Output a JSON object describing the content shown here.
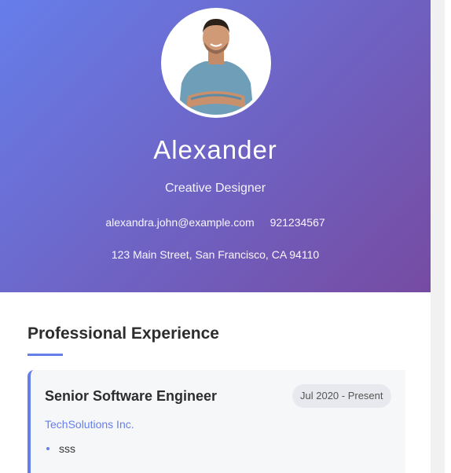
{
  "profile": {
    "name": "Alexander",
    "title": "Creative Designer",
    "email": "alexandra.john@example.com",
    "phone": "921234567",
    "address": "123 Main Street, San Francisco, CA 94110"
  },
  "experience": {
    "section_title": "Professional Experience",
    "jobs": [
      {
        "title": "Senior Software Engineer",
        "date": "Jul 2020 - Present",
        "company": "TechSolutions Inc.",
        "bullets": [
          "sss"
        ]
      }
    ]
  },
  "colors": {
    "gradient_start": "#667eea",
    "gradient_end": "#764ba2",
    "accent": "#667eea"
  }
}
